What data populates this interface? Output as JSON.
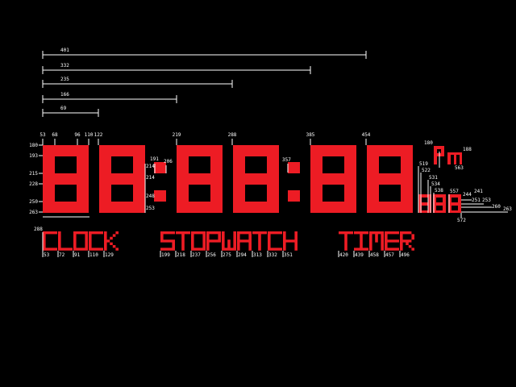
{
  "colors": {
    "background": "#000000",
    "segment": "#ed1c24",
    "annotation": "#ffffff"
  },
  "width_guides": [
    "401",
    "332",
    "235",
    "166",
    "69"
  ],
  "clock": {
    "display": "88:88:88",
    "ampm": "pm",
    "small_display": "888"
  },
  "modes": [
    {
      "label": "CLOCK",
      "icon": "clock-mode"
    },
    {
      "label": "STOPWATCH",
      "icon": "stopwatch-mode"
    },
    {
      "label": "TIMER",
      "icon": "timer-mode"
    }
  ],
  "top_labels": [
    "53",
    "68",
    "96",
    "110",
    "122",
    "219",
    "288",
    "385",
    "454"
  ],
  "left_labels": [
    "180",
    "193",
    "215",
    "228",
    "250",
    "263"
  ],
  "colon_labels": [
    "191",
    "206",
    "214",
    "214",
    "248",
    "253"
  ],
  "misc_labels": [
    "357",
    "180",
    "188",
    "563",
    "519",
    "522",
    "531",
    "534",
    "538",
    "557",
    "244",
    "241",
    "251",
    "253",
    "260",
    "263",
    "572"
  ],
  "mode_label_y": "288",
  "clock_ticks": [
    "53",
    "72",
    "91",
    "110",
    "129"
  ],
  "stopwatch_ticks": [
    "199",
    "218",
    "237",
    "256",
    "275",
    "294",
    "313",
    "332",
    "351"
  ],
  "timer_ticks": [
    "420",
    "439",
    "458",
    "457",
    "496"
  ]
}
